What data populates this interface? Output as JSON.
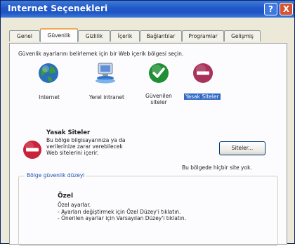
{
  "window": {
    "title": "Internet Seçenekleri"
  },
  "title_buttons": {
    "help": "?",
    "close": "X"
  },
  "tabs": [
    {
      "label": "Genel"
    },
    {
      "label": "Güvenlik"
    },
    {
      "label": "Gizlilik"
    },
    {
      "label": "İçerik"
    },
    {
      "label": "Bağlantılar"
    },
    {
      "label": "Programlar"
    },
    {
      "label": "Gelişmiş"
    }
  ],
  "active_tab": "Güvenlik",
  "security": {
    "instruction": "Güvenlik ayarlarını belirlemek için bir Web içerik bölgesi seçin.",
    "zones": [
      {
        "label": "Internet",
        "icon": "globe-icon"
      },
      {
        "label": "Yerel intranet",
        "icon": "network-computer-icon"
      },
      {
        "label": "Güvenilen siteler",
        "icon": "check-circle-icon"
      },
      {
        "label": "Yasak Siteler",
        "icon": "no-entry-icon"
      }
    ],
    "selected_zone": "Yasak Siteler",
    "zone_info": {
      "heading": "Yasak Siteler",
      "description": "Bu bölge bilgisayarınıza ya da verilerinize zarar verebilecek Web sitelerini içerir.",
      "sites_button": "Siteler...",
      "no_sites_text": "Bu bölgede hiçbir site yok."
    },
    "level_group": {
      "title": "Bölge güvenlik düzeyi",
      "level_name": "Özel",
      "level_lines": [
        "Özel ayarlar.",
        "- Ayarları değiştirmek için Özel Düzey'i tıklatın.",
        "- Önerilen ayarlar için Varsayılan Düzey'i tıklatın."
      ]
    }
  },
  "colors": {
    "title_bar": "#2157c7",
    "selection": "#316ac5",
    "tab_highlight": "#f6a84a",
    "restricted_red": "#c8233a",
    "trusted_green": "#1f8f35"
  }
}
